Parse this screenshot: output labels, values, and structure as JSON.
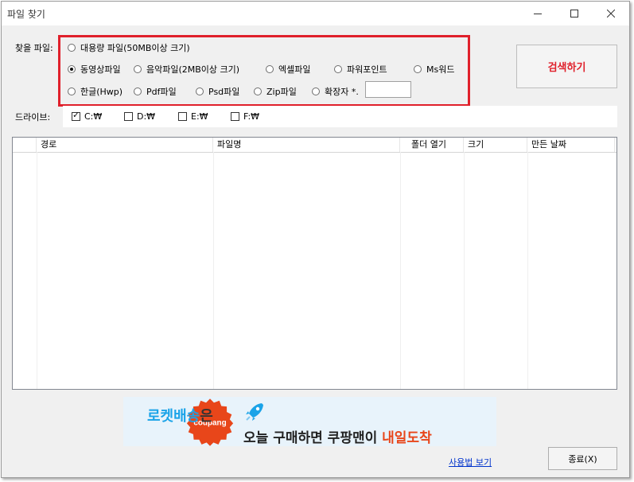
{
  "window": {
    "title": "파일 찾기"
  },
  "file_type": {
    "label": "찾을 파일:",
    "options": [
      {
        "label": "대용량 파일(50MB이상 크기)",
        "selected": false
      },
      {
        "label": "동영상파일",
        "selected": true
      },
      {
        "label": "음악파일(2MB이상 크기)",
        "selected": false
      },
      {
        "label": "엑셀파일",
        "selected": false
      },
      {
        "label": "파워포인트",
        "selected": false
      },
      {
        "label": "Ms워드",
        "selected": false
      },
      {
        "label": "한글(Hwp)",
        "selected": false
      },
      {
        "label": "Pdf파일",
        "selected": false
      },
      {
        "label": "Psd파일",
        "selected": false
      },
      {
        "label": "Zip파일",
        "selected": false
      },
      {
        "label": "확장자 *.",
        "selected": false
      }
    ],
    "extension_value": "",
    "highlight_color": "#e0202b"
  },
  "search_button": {
    "label": "검색하기",
    "color": "#e0202b"
  },
  "drives": {
    "label": "드라이브:",
    "items": [
      {
        "label": "C:₩",
        "checked": true
      },
      {
        "label": "D:₩",
        "checked": false
      },
      {
        "label": "E:₩",
        "checked": false
      },
      {
        "label": "F:₩",
        "checked": false
      }
    ]
  },
  "results": {
    "columns": [
      "경로",
      "파일명",
      "폴더 열기",
      "크기",
      "만든 날짜"
    ],
    "rows": []
  },
  "banner": {
    "brand": "coupang",
    "headline": "로켓배송",
    "headline_suffix": "은",
    "subline": "오늘 구매하면 쿠팡맨이 ",
    "subline_highlight": "내일도착",
    "brand_color": "#e8461a",
    "accent_color": "#1aa3e8"
  },
  "footer": {
    "help_link": "사용법 보기",
    "close_button": "종료(X)"
  }
}
